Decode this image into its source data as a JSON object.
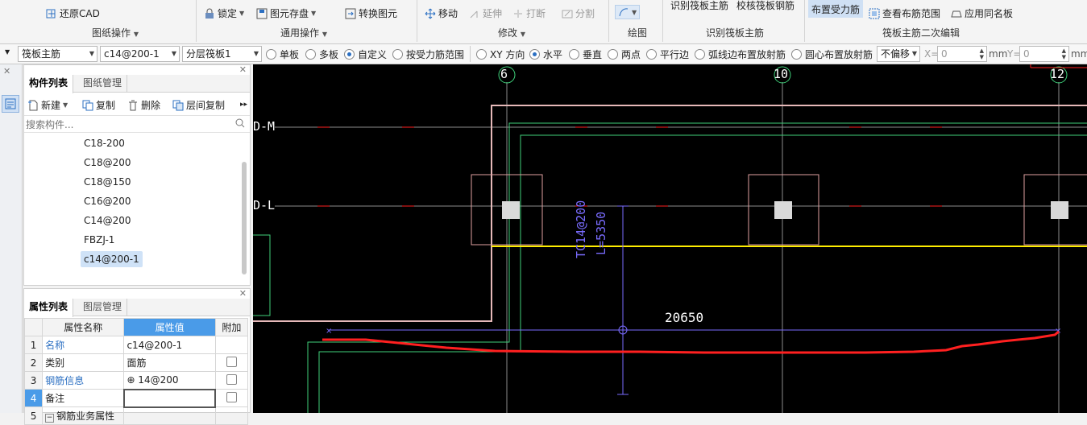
{
  "ribbon": {
    "restore_cad": "还原CAD",
    "group_drawing_ops": "图纸操作",
    "lock": "锁定",
    "save_element": "图元存盘",
    "convert_element": "转换图元",
    "group_general_ops": "通用操作",
    "move": "移动",
    "extend": "延伸",
    "break": "打断",
    "split": "分割",
    "group_modify": "修改",
    "group_draw": "绘图",
    "identify_main_bar": "识别筏板主筋",
    "check_raft_bar": "校核筏板钢筋",
    "group_identify": "识别筏板主筋",
    "place_stress_bar": "布置受力筋",
    "view_bar_range": "查看布筋范围",
    "apply_same_name": "应用同名板",
    "group_secondary": "筏板主筋二次编辑"
  },
  "options": {
    "type_select": "筏板主筋",
    "spec_select": "c14@200-1",
    "layer_select": "分层筏板1",
    "radio_single": "单板",
    "radio_multi": "多板",
    "radio_custom": "自定义",
    "radio_by_range": "按受力筋范围",
    "radio_xy": "XY 方向",
    "radio_horizontal": "水平",
    "radio_vertical": "垂直",
    "radio_two_points": "两点",
    "radio_parallel": "平行边",
    "radio_arc": "弧线边布置放射筋",
    "radio_circle": "圆心布置放射筋",
    "offset_select": "不偏移",
    "x_label": "X=",
    "x_value": "0",
    "unit_mm": "mm",
    "y_label": "Y=",
    "y_value": "0",
    "unit_mm2": "mm"
  },
  "component_panel": {
    "tab_list": "构件列表",
    "tab_drawing": "图纸管理",
    "new_btn": "新建",
    "copy_btn": "复制",
    "delete_btn": "删除",
    "floor_copy_btn": "层间复制",
    "search_placeholder": "搜索构件...",
    "items": [
      "C18-200",
      "C18@200",
      "C18@150",
      "C16@200",
      "C14@200",
      "FBZJ-1",
      "c14@200-1"
    ]
  },
  "property_panel": {
    "tab_props": "属性列表",
    "tab_layers": "图层管理",
    "col_name": "属性名称",
    "col_value": "属性值",
    "col_extra": "附加",
    "rows": [
      {
        "num": "1",
        "name": "名称",
        "value": "c14@200-1"
      },
      {
        "num": "2",
        "name": "类别",
        "value": "面筋"
      },
      {
        "num": "3",
        "name": "钢筋信息",
        "value": "⊕ 14@200"
      },
      {
        "num": "4",
        "name": "备注",
        "value": ""
      },
      {
        "num": "5",
        "name": "钢筋业务属性",
        "value": ""
      }
    ]
  },
  "canvas": {
    "axis_6": "6",
    "axis_10": "10",
    "axis_12": "12",
    "axis_dm": "D-M",
    "axis_dl": "D-L",
    "rebar_label": "TC14@200",
    "length_label": "L=5350",
    "dimension": "20650"
  },
  "colors": {
    "canvas_bg": "#000000",
    "grid": "#8c8c8c",
    "highlight_red": "#ff2020",
    "yellow": "#ffee00",
    "blue_line": "#7a6cff",
    "green_line": "#3fd07a"
  }
}
